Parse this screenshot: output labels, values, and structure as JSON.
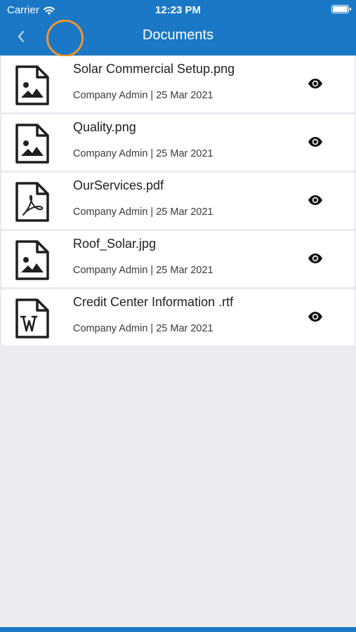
{
  "status_bar": {
    "carrier": "Carrier",
    "time": "12:23 PM",
    "wifi_icon": "wifi-icon",
    "battery_icon": "battery-icon"
  },
  "nav": {
    "title": "Documents",
    "back_icon": "chevron-left-icon"
  },
  "colors": {
    "header": "#1a78c6",
    "highlight_ring": "#f0962f",
    "background": "#e9ebee",
    "row": "#ffffff"
  },
  "documents": [
    {
      "name": "Solar Commercial Setup.png",
      "meta": "Company Admin | 25 Mar 2021",
      "file_type": "image",
      "icon": "image-file-icon",
      "action_icon": "eye-icon"
    },
    {
      "name": "Quality.png",
      "meta": "Company Admin | 25 Mar 2021",
      "file_type": "image",
      "icon": "image-file-icon",
      "action_icon": "eye-icon"
    },
    {
      "name": "OurServices.pdf",
      "meta": "Company Admin | 25 Mar 2021",
      "file_type": "pdf",
      "icon": "pdf-file-icon",
      "action_icon": "eye-icon"
    },
    {
      "name": "Roof_Solar.jpg",
      "meta": "Company Admin | 25 Mar 2021",
      "file_type": "image",
      "icon": "image-file-icon",
      "action_icon": "eye-icon"
    },
    {
      "name": "Credit Center Information .rtf",
      "meta": "Company Admin | 25 Mar 2021",
      "file_type": "word",
      "icon": "word-file-icon",
      "action_icon": "eye-icon"
    }
  ]
}
